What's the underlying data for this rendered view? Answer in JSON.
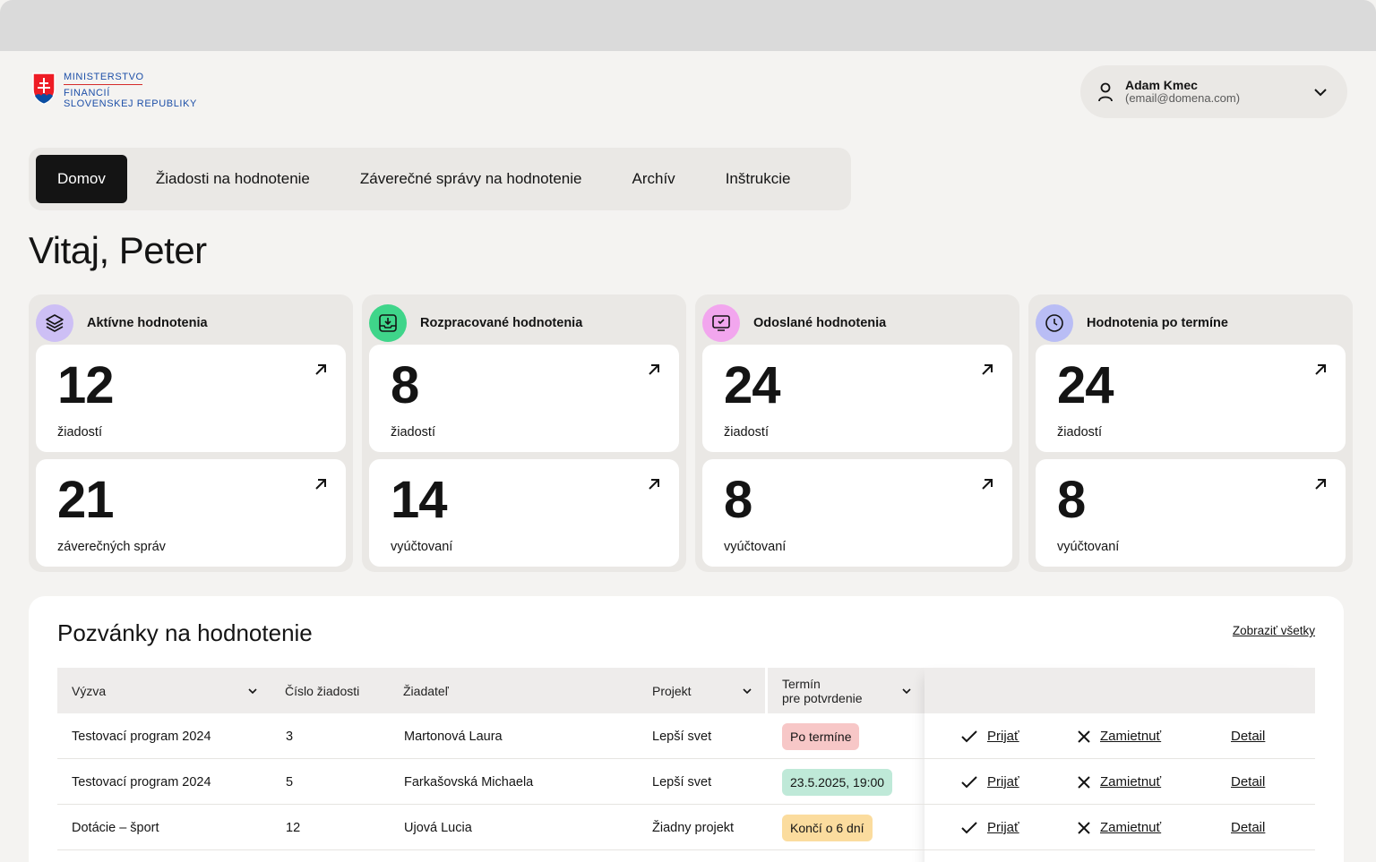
{
  "logo": {
    "line1": "MINISTERSTVO",
    "line2": "FINANCIÍ",
    "line3": "SLOVENSKEJ REPUBLIKY",
    "crest_icon": "slovak-coat-of-arms"
  },
  "user": {
    "name": "Adam Kmec",
    "email": "(email@domena.com)"
  },
  "tabs": [
    "Domov",
    "Žiadosti na hodnotenie",
    "Záverečné správy na hodnotenie",
    "Archív",
    "Inštrukcie"
  ],
  "greeting": "Vitaj, Peter",
  "cards": [
    {
      "title": "Aktívne hodnotenia",
      "icon": "layers-icon",
      "icon_bg": "#cdbff5",
      "stats": [
        {
          "value": "12",
          "label": "žiadostí"
        },
        {
          "value": "21",
          "label": "záverečných správ"
        }
      ]
    },
    {
      "title": "Rozpracované hodnotenia",
      "icon": "inbox-download-icon",
      "icon_bg": "#3fd58a",
      "stats": [
        {
          "value": "8",
          "label": "žiadostí"
        },
        {
          "value": "14",
          "label": "vyúčtovaní"
        }
      ]
    },
    {
      "title": "Odoslané hodnotenia",
      "icon": "monitor-check-icon",
      "icon_bg": "#f2a6ee",
      "stats": [
        {
          "value": "24",
          "label": "žiadostí"
        },
        {
          "value": "8",
          "label": "vyúčtovaní"
        }
      ]
    },
    {
      "title": "Hodnotenia po termíne",
      "icon": "clock-icon",
      "icon_bg": "#b9bdf5",
      "stats": [
        {
          "value": "24",
          "label": "žiadostí"
        },
        {
          "value": "8",
          "label": "vyúčtovaní"
        }
      ]
    }
  ],
  "invitations": {
    "title": "Pozvánky na hodnotenie",
    "show_all": "Zobraziť všetky",
    "columns": [
      "Výzva",
      "Číslo žiadosti",
      "Žiadateľ",
      "Projekt",
      "Termín",
      "pre potvrdenie"
    ],
    "accept": "Prijať",
    "reject": "Zamietnuť",
    "detail": "Detail",
    "rows": [
      {
        "call": "Testovací program 2024",
        "number": "3",
        "applicant": "Martonová Laura",
        "project": "Lepší svet",
        "deadline": "Po termíne",
        "deadline_color": "#f7c7c7"
      },
      {
        "call": "Testovací program 2024",
        "number": "5",
        "applicant": "Farkašovská Michaela",
        "project": "Lepší svet",
        "deadline": "23.5.2025, 19:00",
        "deadline_color": "#bfe9d8"
      },
      {
        "call": "Dotácie – šport",
        "number": "12",
        "applicant": "Ujová Lucia",
        "project": "Žiadny projekt",
        "deadline": "Končí o 6 dní",
        "deadline_color": "#fbdc9e"
      }
    ]
  }
}
